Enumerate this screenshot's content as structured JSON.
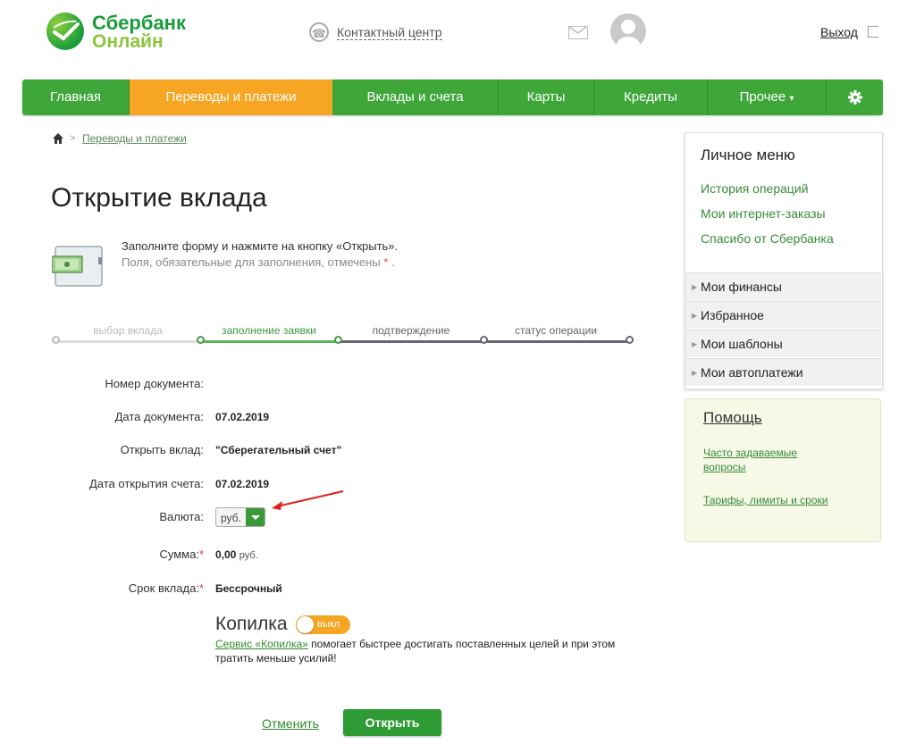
{
  "header": {
    "logo_line1": "Сбербанк",
    "logo_line2": "Онлайн",
    "contact": "Контактный центр",
    "logout": "Выход"
  },
  "nav": [
    "Главная",
    "Переводы и платежи",
    "Вклады и счета",
    "Карты",
    "Кредиты",
    "Прочее"
  ],
  "nav_more_arrow": "▾",
  "breadcrumb": {
    "link": "Переводы и платежи"
  },
  "page": {
    "title": "Открытие вклада",
    "hint_line1": "Заполните форму и нажмите на кнопку «Открыть».",
    "hint_line2": "Поля, обязательные для заполнения, отмечены",
    "hint_star": "*",
    "hint_end": "."
  },
  "steps": [
    "выбор вклада",
    "заполнение заявки",
    "подтверждение",
    "статус операции"
  ],
  "form": {
    "doc_number_label": "Номер документа:",
    "doc_date_label": "Дата документа:",
    "doc_date": "07.02.2019",
    "open_label": "Открыть вклад:",
    "open_value": "\"Сберегательный счет\"",
    "open_date_label": "Дата открытия счета:",
    "open_date": "07.02.2019",
    "currency_label": "Валюта:",
    "currency_value": "руб.",
    "sum_label": "Сумма:",
    "sum_value": "0,00",
    "sum_unit": "руб.",
    "term_label": "Срок вклада:",
    "term_value": "Бессрочный",
    "required_star": "*"
  },
  "kopilka": {
    "title": "Копилка",
    "toggle": "выкл",
    "link": "Сервис «Копилка»",
    "desc": " помогает быстрее достигать поставленных целей и при этом тратить меньше усилий!"
  },
  "actions": {
    "cancel": "Отменить",
    "open": "Открыть"
  },
  "personal_menu": {
    "title": "Личное меню",
    "links": [
      "История операций",
      "Мои интернет-заказы",
      "Спасибо от Сбербанка"
    ],
    "sections": [
      "Мои финансы",
      "Избранное",
      "Мои шаблоны",
      "Мои автоплатежи"
    ]
  },
  "help": {
    "title": "Помощь",
    "link1": "Часто задаваемые вопросы",
    "link2": "Тарифы, лимиты и сроки"
  },
  "colors": {
    "brand_green": "#3fa73a",
    "accent_orange": "#f6a623"
  }
}
